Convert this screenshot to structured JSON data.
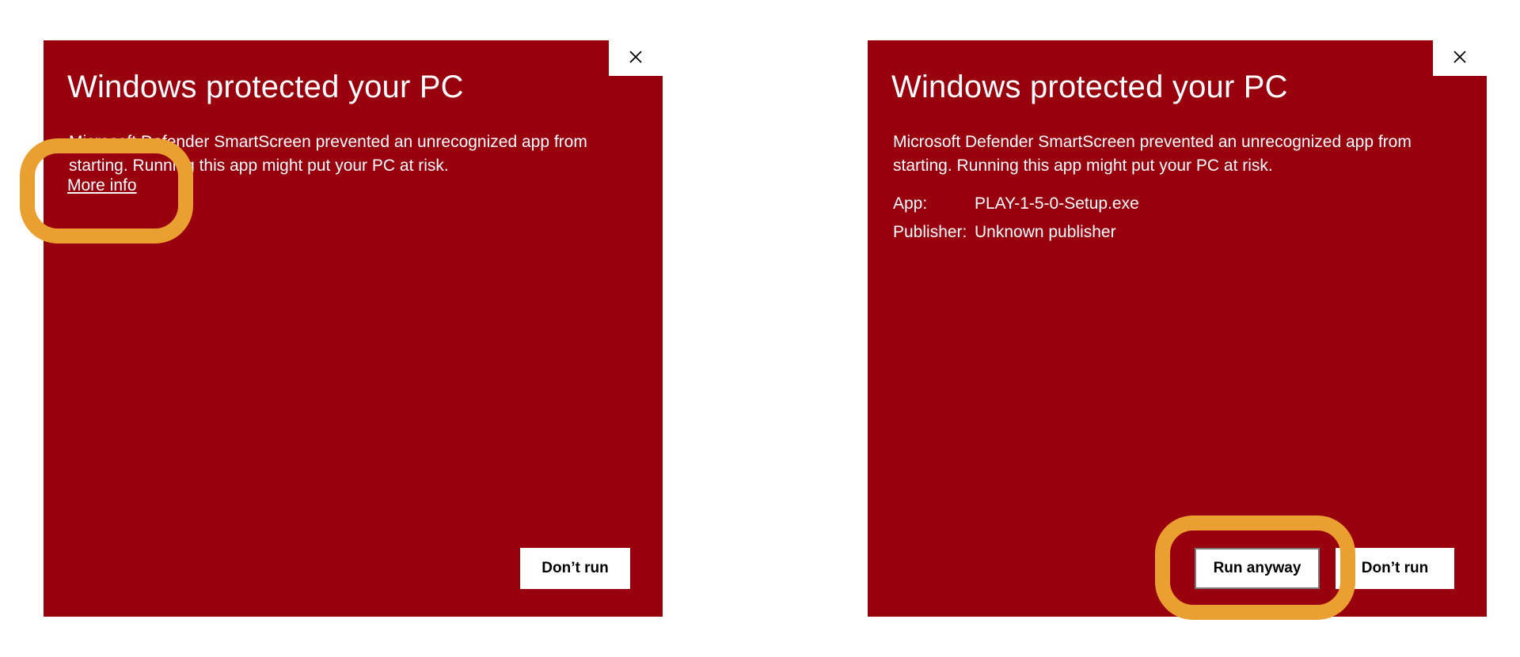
{
  "left_dialog": {
    "title": "Windows protected your PC",
    "message": "Microsoft Defender SmartScreen prevented an unrecognized app from starting. Running this app might put your PC at risk.",
    "more_info_link": "More info",
    "dont_run_label": "Don’t run",
    "close_icon": "close-icon"
  },
  "right_dialog": {
    "title": "Windows protected your PC",
    "message": "Microsoft Defender SmartScreen prevented an unrecognized app from starting. Running this app might put your PC at risk.",
    "details": {
      "app_key": "App:",
      "app_value": "PLAY-1-5-0-Setup.exe",
      "publisher_key": "Publisher:",
      "publisher_value": "Unknown publisher"
    },
    "run_anyway_label": "Run anyway",
    "dont_run_label": "Don’t run",
    "close_icon": "close-icon"
  },
  "colors": {
    "dialog_background": "#98000e",
    "highlight": "#eaa030",
    "button_background": "#ffffff"
  }
}
